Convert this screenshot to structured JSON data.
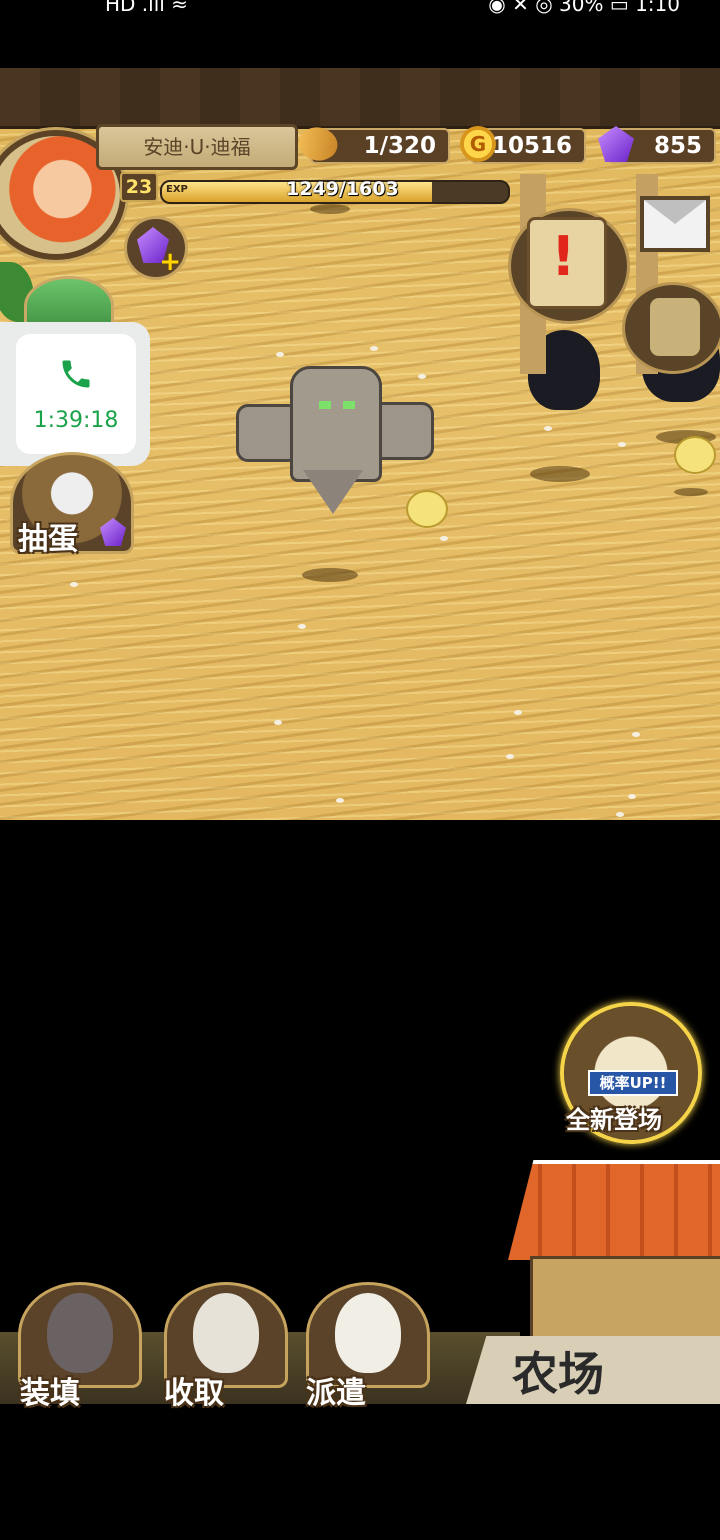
{
  "statusbar": {
    "left": "HD .ıll ≈",
    "right": "◉ ✕ ◎ 30% ▭ 1:10"
  },
  "player": {
    "name": "安迪·U·迪福",
    "level": "23",
    "exp_tag": "EXP",
    "exp_text": "1249/1603",
    "exp_fraction": 0.779
  },
  "resources": {
    "stamina": "1/320",
    "gold": "10516",
    "gold_icon_letter": "G",
    "gems": "855"
  },
  "call": {
    "time": "1:39:18"
  },
  "gacha": {
    "label": "抽蛋"
  },
  "event": {
    "up_label": "概率UP!!",
    "label": "全新登场"
  },
  "bottom_menu": [
    {
      "label": "装填"
    },
    {
      "label": "收取"
    },
    {
      "label": "派遣"
    }
  ],
  "farm": {
    "label": "农场"
  },
  "icons": {
    "stamina": "bread-icon",
    "gold": "coin-icon",
    "gems": "gem-icon",
    "add_gems": "gem-plus-icon",
    "quest": "scroll-icon",
    "mail": "envelope-icon",
    "bag": "backpack-icon",
    "gift": "gift-icon",
    "phone": "phone-icon"
  }
}
